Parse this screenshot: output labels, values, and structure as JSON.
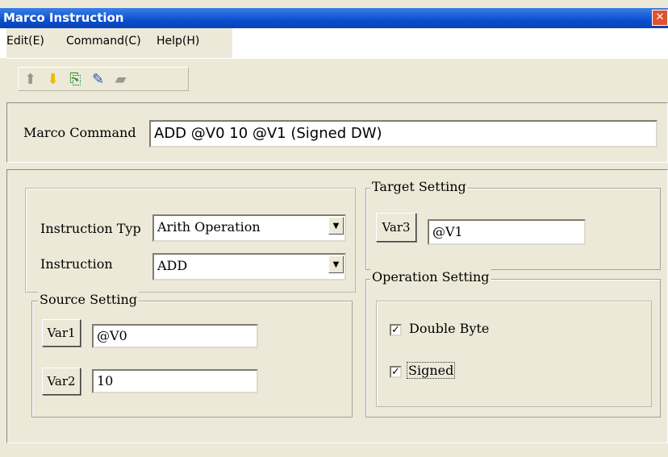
{
  "window": {
    "title": "Marco Instruction",
    "close_glyph": "✕"
  },
  "menu": {
    "items": [
      {
        "label": "Edit(E)"
      },
      {
        "label": "Command(C)"
      },
      {
        "label": "Help(H)"
      }
    ]
  },
  "toolbar": {
    "buttons": [
      {
        "icon": "arrow-up-icon",
        "glyph": "⬆",
        "color": "#9a9890",
        "enabled": false
      },
      {
        "icon": "arrow-down-icon",
        "glyph": "⬇",
        "color": "#e8c000",
        "enabled": true
      },
      {
        "icon": "insert-icon",
        "glyph": "⎘",
        "color": "#2a8a2a",
        "enabled": true
      },
      {
        "icon": "edit-icon",
        "glyph": "✎",
        "color": "#2050c0",
        "enabled": true
      },
      {
        "icon": "eraser-icon",
        "glyph": "▰",
        "color": "#9a9890",
        "enabled": false
      }
    ]
  },
  "command": {
    "label": "Marco Command",
    "value": "ADD  @V0  10  @V1 (Signed DW)"
  },
  "instruction": {
    "type_label": "Instruction Typ",
    "type_value": "Arith Operation",
    "instr_label": "Instruction",
    "instr_value": "ADD"
  },
  "source": {
    "title": "Source Setting",
    "var1_label": "Var1",
    "var1_value": "@V0",
    "var2_label": "Var2",
    "var2_value": "10"
  },
  "target": {
    "title": "Target Setting",
    "var3_label": "Var3",
    "var3_value": "@V1"
  },
  "operation": {
    "title": "Operation Setting",
    "double_byte_label": "Double Byte",
    "double_byte_checked": true,
    "signed_label": "Signed",
    "signed_checked": true
  },
  "colors": {
    "titlebar": "#0a4fd0",
    "face": "#ece9d8",
    "close": "#e0532e"
  }
}
